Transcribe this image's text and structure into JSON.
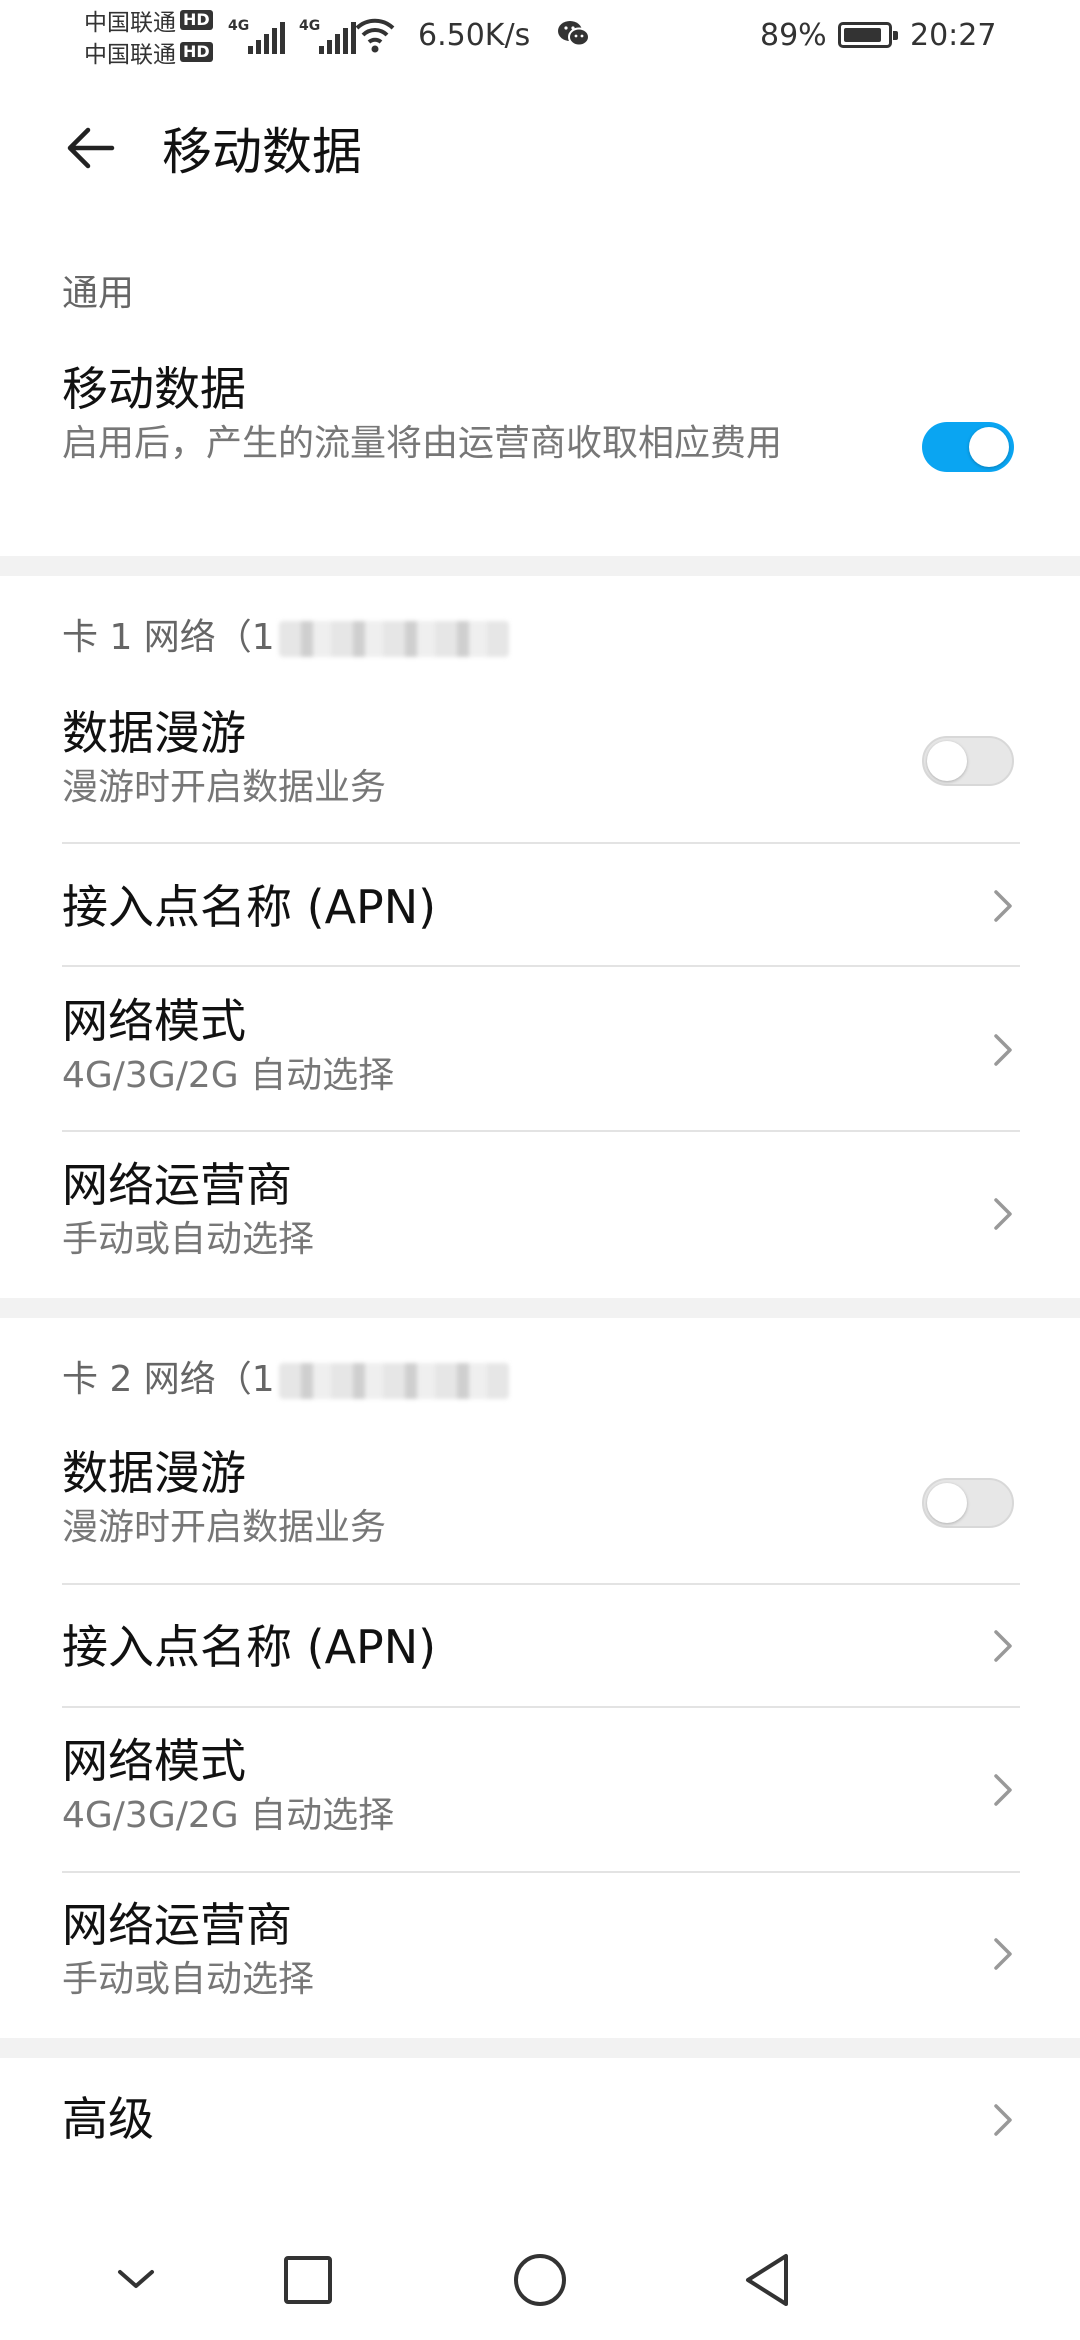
{
  "status": {
    "carrier1": "中国联通",
    "carrier2": "中国联通",
    "hd": "HD",
    "net1": "4G",
    "net2": "4G",
    "speed": "6.50K/s",
    "battery_pct": "89%",
    "battery_level": 0.89,
    "time": "20:27"
  },
  "appbar": {
    "title": "移动数据"
  },
  "general": {
    "label": "通用",
    "mobile_data": {
      "title": "移动数据",
      "desc": "启用后，产生的流量将由运营商收取相应费用",
      "enabled": true
    }
  },
  "sim1": {
    "header": "卡 1 网络（1",
    "roaming": {
      "title": "数据漫游",
      "desc": "漫游时开启数据业务",
      "enabled": false
    },
    "apn": {
      "title": "接入点名称 (APN)"
    },
    "mode": {
      "title": "网络模式",
      "desc": "4G/3G/2G 自动选择"
    },
    "operator": {
      "title": "网络运营商",
      "desc": "手动或自动选择"
    }
  },
  "sim2": {
    "header": "卡 2 网络（1",
    "roaming": {
      "title": "数据漫游",
      "desc": "漫游时开启数据业务",
      "enabled": false
    },
    "apn": {
      "title": "接入点名称 (APN)"
    },
    "mode": {
      "title": "网络模式",
      "desc": "4G/3G/2G 自动选择"
    },
    "operator": {
      "title": "网络运营商",
      "desc": "手动或自动选择"
    }
  },
  "advanced": {
    "title": "高级"
  },
  "colors": {
    "accent": "#0aa5f2",
    "toggle_off": "#e7e7e7",
    "divider": "#e3e3e3",
    "section_gap": "#f2f2f2"
  },
  "icons": [
    "back-arrow-icon",
    "chevron-right-icon",
    "wifi-icon",
    "wechat-icon",
    "battery-icon",
    "nav-collapse-icon",
    "nav-recents-icon",
    "nav-home-icon",
    "nav-back-icon"
  ]
}
